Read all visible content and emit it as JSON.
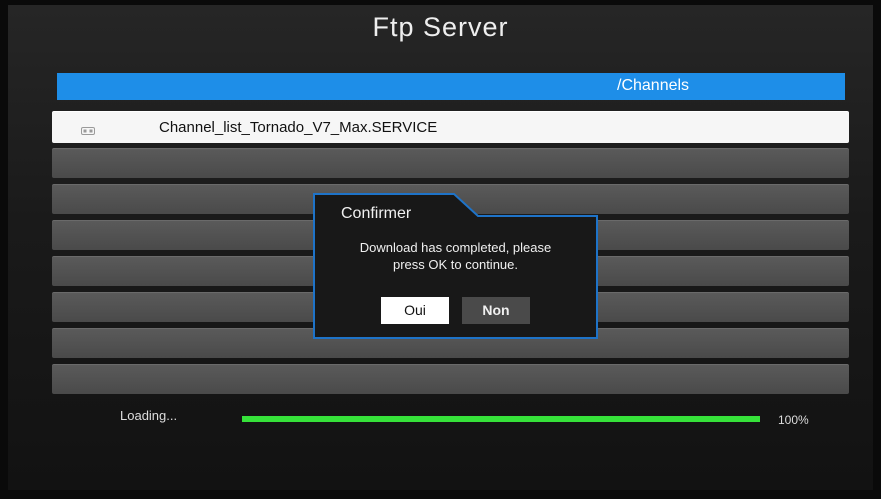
{
  "header": {
    "title": "Ftp Server"
  },
  "path": "/Channels",
  "files": [
    {
      "name": "Channel_list_Tornado_V7_Max.SERVICE",
      "icon": "file-icon",
      "selected": true
    }
  ],
  "dialog": {
    "title": "Confirmer",
    "message_line1": "Download has completed, please",
    "message_line2": "press OK to continue.",
    "yes_label": "Oui",
    "no_label": "Non"
  },
  "status": {
    "loading_label": "Loading...",
    "progress": 1.0,
    "percent_label": "100%"
  },
  "colors": {
    "accent": "#1e8ee8",
    "progress": "#36e23a",
    "dialog_border": "#1e73c8"
  }
}
